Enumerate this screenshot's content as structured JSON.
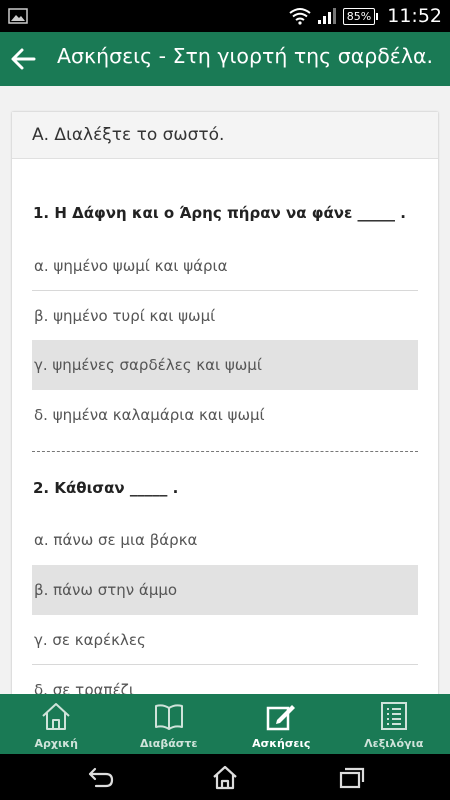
{
  "status_bar": {
    "battery": "85%",
    "time": "11:52"
  },
  "app_bar": {
    "title": "Ασκήσεις - Στη γιορτή της σαρδέλα."
  },
  "section": {
    "title": "Α. Διαλέξτε το σωστό."
  },
  "questions": [
    {
      "text": "1. Η Δάφνη και ο Άρης πήραν να φάνε _____ .",
      "options": [
        {
          "label": "α. ψημένο ψωμί και ψάρια",
          "selected": false
        },
        {
          "label": "β. ψημένο τυρί και ψωμί",
          "selected": false
        },
        {
          "label": "γ. ψημένες σαρδέλες και ψωμί",
          "selected": true
        },
        {
          "label": "δ. ψημένα καλαμάρια και ψωμί",
          "selected": false
        }
      ]
    },
    {
      "text": "2. Κάθισαν _____ .",
      "options": [
        {
          "label": "α. πάνω σε μια βάρκα",
          "selected": false
        },
        {
          "label": "β. πάνω στην άμμο",
          "selected": true
        },
        {
          "label": "γ. σε καρέκλες",
          "selected": false
        },
        {
          "label": "δ. σε τραπέζι",
          "selected": false
        }
      ]
    }
  ],
  "bottom_nav": [
    {
      "label": "Αρχική",
      "icon": "home-icon",
      "active": false
    },
    {
      "label": "Διαβάστε",
      "icon": "book-icon",
      "active": false
    },
    {
      "label": "Ασκήσεις",
      "icon": "edit-icon",
      "active": true
    },
    {
      "label": "Λεξιλόγια",
      "icon": "list-icon",
      "active": false
    }
  ],
  "colors": {
    "primary": "#1a7a55",
    "selected_option": "#e2e2e2"
  }
}
